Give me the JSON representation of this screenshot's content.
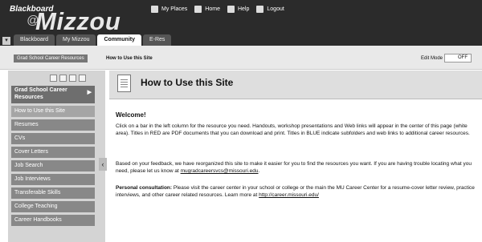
{
  "header": {
    "logo_small": "Blackboard",
    "logo_at": "@",
    "logo_big": "Mizzou",
    "links": [
      "My Places",
      "Home",
      "Help",
      "Logout"
    ]
  },
  "tabs": [
    "Blackboard",
    "My Mizzou",
    "Community",
    "E-Res"
  ],
  "active_tab": "Community",
  "breadcrumb": {
    "crumb1": "Grad School Career Resources",
    "crumb2": "How to Use this Site"
  },
  "edit_mode": {
    "label": "Edit Mode",
    "value": "OFF"
  },
  "left": {
    "header": "Grad School Career Resources",
    "items": [
      "How to Use this Site",
      "Resumes",
      "CVs",
      "Cover Letters",
      "Job Search",
      "Job Interviews",
      "Transferable Skills",
      "College Teaching",
      "Career Handbooks"
    ]
  },
  "main": {
    "title": "How to Use this Site",
    "welcome": "Welcome!",
    "p1": "Click on a bar in the left column for the resource you need. Handouts, workshop presentations and Web links will appear in the center of this page (white area). Titles in RED are PDF documents that you can download and print. Titles in BLUE indicate subfolders and web links to additional career resources.",
    "p2_text": "Based on your feedback, we have reorganized this site to make it easier for you to find the resources you want. If you are having trouble locating what you need, please let us know at",
    "p2_email": "mugradcareersvcs@missouri.edu",
    "p3_label": "Personal consultation:",
    "p3_text": "Please visit the career center in your school or college or the main the MU Career Center for a resume-cover letter review, practice interviews, and other career related resources. Learn more at",
    "p3_link": "http://career.missouri.edu/"
  }
}
